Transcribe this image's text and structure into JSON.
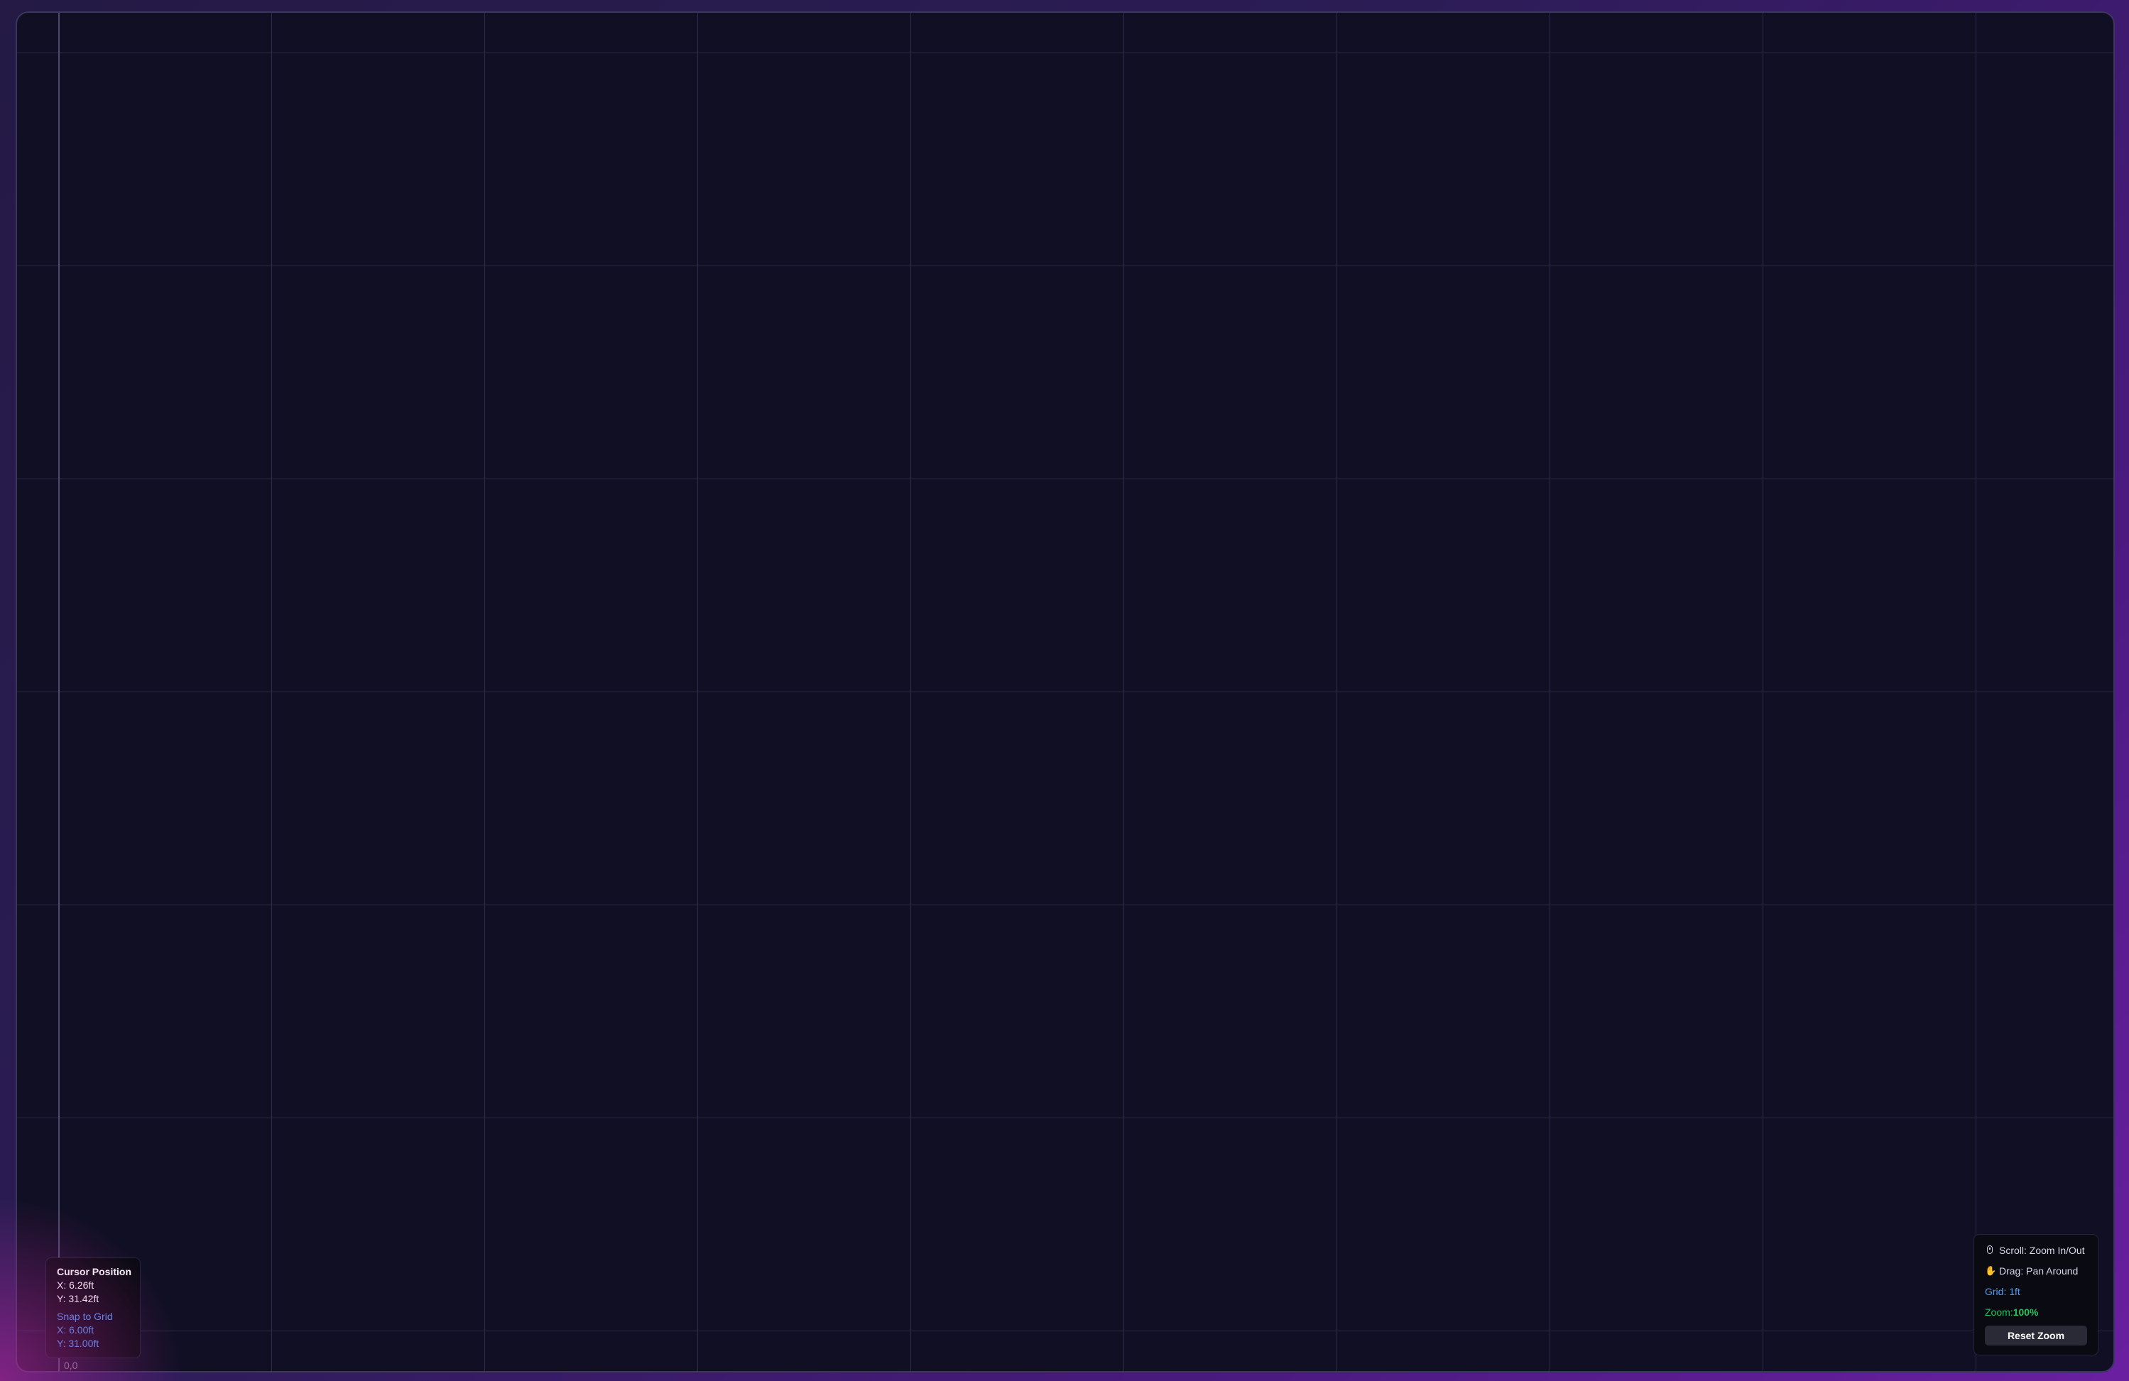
{
  "canvas": {
    "origin_label": "0,0"
  },
  "cursor_panel": {
    "title": "Cursor Position",
    "x": "X: 6.26ft",
    "y": "Y: 31.42ft",
    "snap_title": "Snap to Grid",
    "snap_x": "X: 6.00ft",
    "snap_y": "Y: 31.00ft"
  },
  "help_panel": {
    "scroll_icon": "mouse-icon",
    "scroll_label": "Scroll: Zoom In/Out",
    "drag_icon": "hand-icon",
    "drag_label": "Drag: Pan Around",
    "grid_label": "Grid: 1ft",
    "zoom_label": "Zoom: ",
    "zoom_value": "100%",
    "reset_label": "Reset Zoom"
  },
  "colors": {
    "canvas_bg": "#110f24",
    "grid_line": "#2c2a48",
    "snap_accent": "#4f9df5",
    "zoom_accent": "#22c55e",
    "frame_gradient_end": "#6a1fa0"
  }
}
